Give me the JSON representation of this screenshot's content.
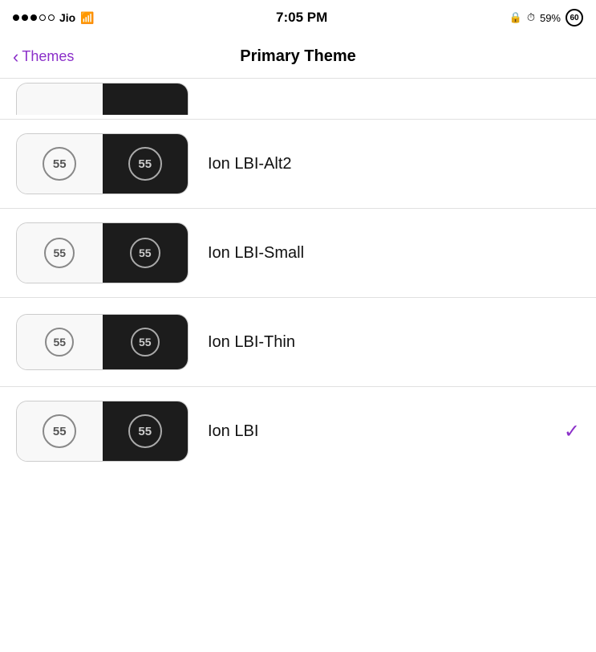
{
  "statusBar": {
    "carrier": "Jio",
    "time": "7:05 PM",
    "battery": "59%",
    "batteryBadge": "60"
  },
  "navBar": {
    "backLabel": "Themes",
    "title": "Primary Theme"
  },
  "themes": [
    {
      "name": "Ion LBI-Alt2",
      "badgeValue": "55",
      "selected": false
    },
    {
      "name": "Ion LBI-Small",
      "badgeValue": "55",
      "selected": false,
      "variant": "small"
    },
    {
      "name": "Ion LBI-Thin",
      "badgeValue": "55",
      "selected": false,
      "variant": "thin"
    },
    {
      "name": "Ion LBI",
      "badgeValue": "55",
      "selected": true
    }
  ]
}
